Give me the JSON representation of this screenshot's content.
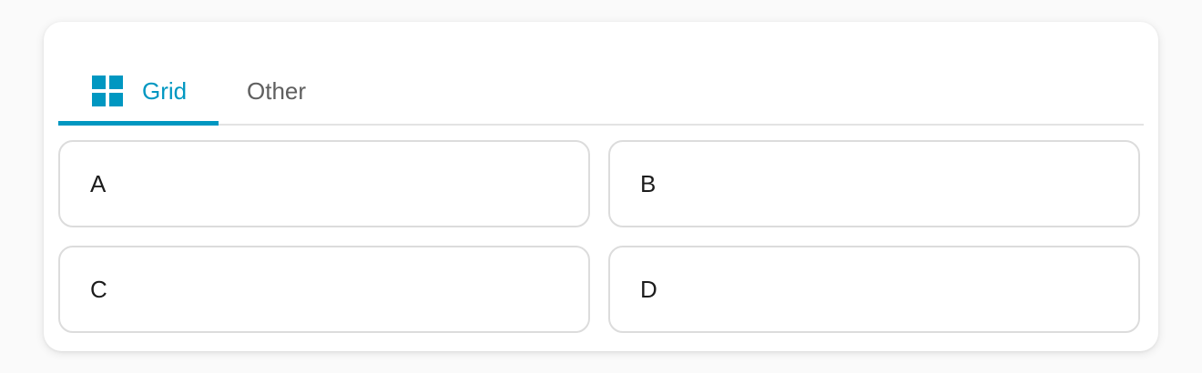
{
  "tabs": [
    {
      "label": "Grid",
      "icon": "grid-icon",
      "selected": true
    },
    {
      "label": "Other",
      "selected": false
    }
  ],
  "grid": {
    "items": [
      {
        "label": "A"
      },
      {
        "label": "B"
      },
      {
        "label": "C"
      },
      {
        "label": "D"
      }
    ]
  },
  "colors": {
    "accent": "#0097c1",
    "tab_inactive": "#5f5f5f",
    "item_border": "#dcdcdc"
  }
}
